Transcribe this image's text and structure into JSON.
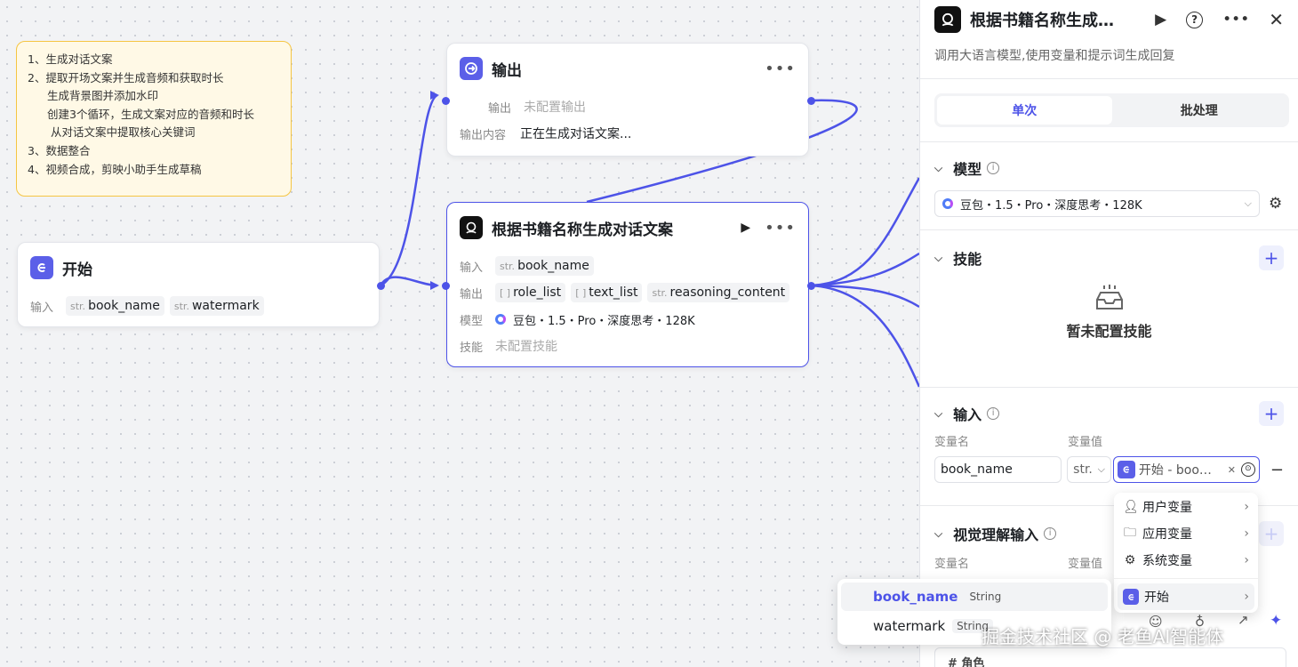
{
  "note": {
    "lines": [
      "1、生成对话文案",
      "2、提取开场文案并生成音频和获取时长",
      "生成背景图并添加水印",
      "创建3个循环，生成文案对应的音频和时长",
      "从对话文案中提取核心关键词",
      "3、数据整合",
      "4、视频合成，剪映小助手生成草稿"
    ]
  },
  "nodes": {
    "start": {
      "title": "开始",
      "input_label": "输入",
      "params": [
        {
          "type": "str.",
          "name": "book_name"
        },
        {
          "type": "str.",
          "name": "watermark"
        }
      ]
    },
    "output": {
      "title": "输出",
      "output_label": "输出",
      "output_value": "未配置输出",
      "content_label": "输出内容",
      "content_value": "正在生成对话文案..."
    },
    "llm": {
      "title": "根据书籍名称生成对话文案",
      "input_label": "输入",
      "input_params": [
        {
          "type": "str.",
          "name": "book_name"
        }
      ],
      "output_label": "输出",
      "output_params": [
        {
          "type": "[ ]",
          "name": "role_list"
        },
        {
          "type": "[ ]",
          "name": "text_list"
        },
        {
          "type": "str.",
          "name": "reasoning_content"
        }
      ],
      "model_label": "模型",
      "model_value": "豆包・1.5・Pro・深度思考・128K",
      "skill_label": "技能",
      "skill_value": "未配置技能"
    }
  },
  "panel": {
    "title": "根据书籍名称生成…",
    "description": "调用大语言模型,使用变量和提示词生成回复",
    "tabs": [
      "单次",
      "批处理"
    ],
    "model": {
      "heading": "模型",
      "selected": "豆包・1.5・Pro・深度思考・128K"
    },
    "skills": {
      "heading": "技能",
      "empty": "暂未配置技能"
    },
    "inputs": {
      "heading": "输入",
      "col_name": "变量名",
      "col_value": "变量值",
      "var_name": "book_name",
      "type": "str.",
      "ref": "开始 - boo…"
    },
    "vision": {
      "heading": "视觉理解输入",
      "col_name": "变量名",
      "col_value": "变量值"
    },
    "prompt_hint": "# 角色"
  },
  "var_menu": {
    "items": [
      "用户变量",
      "应用变量",
      "系统变量",
      "开始"
    ]
  },
  "sub_menu": {
    "items": [
      {
        "name": "book_name",
        "type": "String"
      },
      {
        "name": "watermark",
        "type": "String"
      }
    ]
  },
  "watermark": "掘金技术社区 @ 老鱼AI智能体",
  "colors": {
    "accent": "#4d53e8",
    "note_bg": "#fff9e6",
    "note_border": "#f5c542"
  },
  "icons": [
    "play-icon",
    "help-icon",
    "more-icon",
    "close-icon",
    "settings-icon",
    "chevron-down-icon",
    "info-icon",
    "plus-icon",
    "user-icon",
    "folder-icon",
    "gear-icon",
    "chevron-right-icon",
    "skill-empty-icon"
  ]
}
